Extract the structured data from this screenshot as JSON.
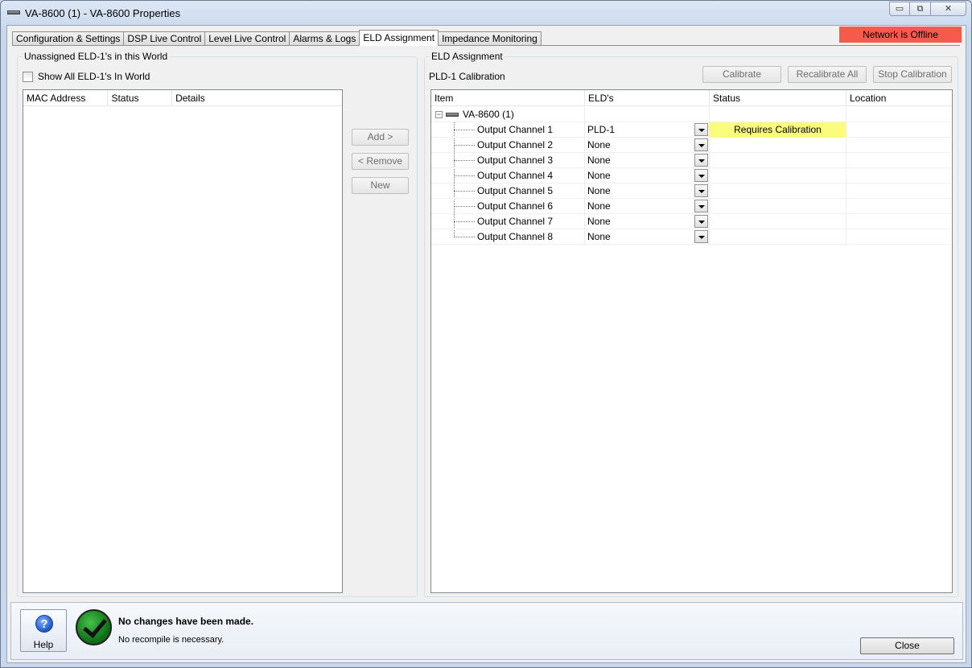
{
  "window": {
    "title": "VA-8600 (1) - VA-8600 Properties",
    "controls": {
      "minimize": "▭",
      "restore": "⧉",
      "close": "✕"
    }
  },
  "tabs": [
    {
      "label": "Configuration & Settings",
      "active": false
    },
    {
      "label": "DSP Live Control",
      "active": false
    },
    {
      "label": "Level Live Control",
      "active": false
    },
    {
      "label": "Alarms & Logs",
      "active": false
    },
    {
      "label": "ELD Assignment",
      "active": true
    },
    {
      "label": "Impedance Monitoring",
      "active": false
    }
  ],
  "network_status": {
    "text": "Network is Offline",
    "color": "#f65a4a"
  },
  "unassigned": {
    "group_label": "Unassigned ELD-1's in this World",
    "show_all_label": "Show All ELD-1's In World",
    "columns": [
      "MAC Address",
      "Status",
      "Details"
    ]
  },
  "middle_buttons": {
    "add": "Add >",
    "remove": "< Remove",
    "new": "New"
  },
  "assignment": {
    "group_label": "ELD Assignment",
    "subtitle": "PLD-1 Calibration",
    "buttons": {
      "calibrate": "Calibrate",
      "recalibrate_all": "Recalibrate All",
      "stop_calibration": "Stop Calibration"
    },
    "columns": [
      "Item",
      "ELD's",
      "Status",
      "Location"
    ],
    "root": "VA-8600 (1)",
    "rows": [
      {
        "item": "Output Channel 1",
        "eld": "PLD-1",
        "status": "Requires Calibration",
        "location": ""
      },
      {
        "item": "Output Channel 2",
        "eld": "None",
        "status": "",
        "location": ""
      },
      {
        "item": "Output Channel 3",
        "eld": "None",
        "status": "",
        "location": ""
      },
      {
        "item": "Output Channel 4",
        "eld": "None",
        "status": "",
        "location": ""
      },
      {
        "item": "Output Channel 5",
        "eld": "None",
        "status": "",
        "location": ""
      },
      {
        "item": "Output Channel 6",
        "eld": "None",
        "status": "",
        "location": ""
      },
      {
        "item": "Output Channel 7",
        "eld": "None",
        "status": "",
        "location": ""
      },
      {
        "item": "Output Channel 8",
        "eld": "None",
        "status": "",
        "location": ""
      }
    ],
    "status_highlight_color": "#fbfb7c"
  },
  "footer": {
    "help_label": "Help",
    "message_title": "No changes have been made.",
    "message_sub": "No recompile is necessary.",
    "close_label": "Close"
  }
}
